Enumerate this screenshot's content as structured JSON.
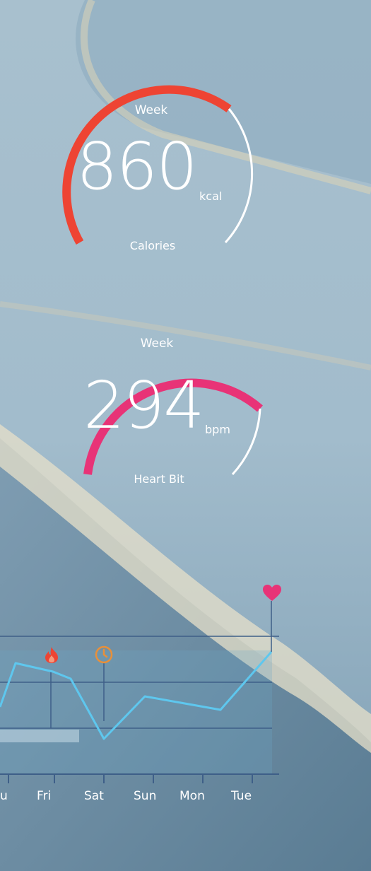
{
  "gauges": [
    {
      "period": "Week",
      "value": "860",
      "unit": "kcal",
      "label": "Calories",
      "color": "#ee4433"
    },
    {
      "period": "Week",
      "value": "294",
      "unit": "bpm",
      "label": "Heart Bit",
      "color": "#e83377"
    }
  ],
  "chart_data": {
    "type": "line",
    "categories": [
      "u",
      "Fri",
      "Sat",
      "Sun",
      "Mon",
      "Tue"
    ],
    "values": [
      9,
      7,
      3,
      6,
      5,
      10
    ],
    "markers": [
      {
        "icon": "flame-icon",
        "color": "#ee4433"
      },
      {
        "icon": "clock-icon",
        "color": "#e8903a"
      },
      {
        "icon": "heart-icon",
        "color": "#e83377"
      }
    ],
    "line_color": "#5ec7ee",
    "grid": true
  }
}
